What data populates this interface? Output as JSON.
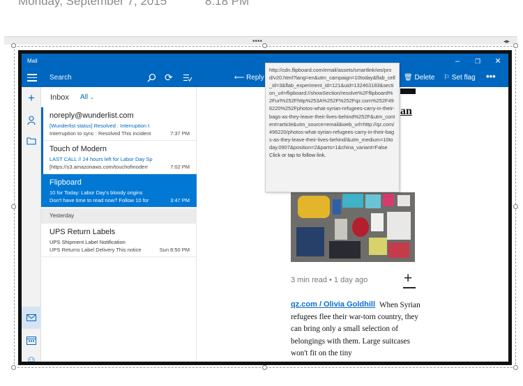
{
  "document": {
    "date": "Monday, September 7, 2015",
    "time": "8:18 PM"
  },
  "app": {
    "title": "Mail"
  },
  "toolbar": {
    "search_placeholder": "Search",
    "reply_label": "Reply",
    "delete_label": "Delete",
    "set_flag_label": "Set flag",
    "more_label": "•••"
  },
  "mail_list": {
    "folder": "Inbox",
    "filter": "All",
    "messages": [
      {
        "sender": "noreply@wunderlist.com",
        "subject": "[Wunderlist status] Resolved : Interruption t",
        "preview": "Interruption to sync : Resolved This incident",
        "time": "7:37 PM"
      },
      {
        "sender": "Touch of Modern",
        "subject": "LAST CALL // 24 hours left for Labor Day Sp",
        "preview": "[https://s3.amazonaws.com/touchofmoderr",
        "time": "7:02 PM"
      },
      {
        "sender": "Flipboard",
        "subject": "10 for Today: Labor Day's bloody origins",
        "preview": "Don't have time to read now? Follow 10 for",
        "time": "3:47 PM"
      }
    ],
    "group_label": "Yesterday",
    "older_messages": [
      {
        "sender": "UPS Return Labels",
        "subject": "UPS Shipment Label Notification",
        "preview": "UPS Returns Label Delivery This notice",
        "time": "Sun 8:50 PM"
      }
    ]
  },
  "tooltip": {
    "url": "http://cdn.flipboard.com/email/assets/smartlink/ws/prod/v20.html?lang=en&utm_campaign=10today&flab_cell_id=3&flab_experiment_id=121&uid=132463183&section_url=flipboard://showSection/resolve%2Fflipboard%2Furl%252Fhttp%253A%252F%252Fqz.com%252F496220%252Fphotos-what-syrian-refugees-carry-in-their-bags-as-they-leave-their-lives-behind%252F&utm_content=article&utm_source=email&web_url=http://qz.com/496220/photos-what-syrian-refugees-carry-in-their-bags-as-they-leave-their-lives-behind/&utm_medium=10today.0907&position=2&parts=1&china_variant=False",
    "hint": "Click or tap to follow link."
  },
  "article": {
    "headline_fragment": "an",
    "read_time": "3 min read • 1 day ago",
    "byline": "qz.com / Olivia Goldhill",
    "body": "When Syrian refugees flee their war-torn country, they can bring only a small selection of belongings with them. Large suitcases won't fit on the tiny"
  },
  "colors": {
    "accent": "#0067c0",
    "selected_row": "#0078d4",
    "link": "#0b6fd0"
  },
  "icons": [
    "search-icon",
    "sync-icon",
    "filter-icon",
    "reply-icon",
    "delete-icon",
    "flag-icon",
    "compose-icon",
    "account-icon",
    "folder-icon",
    "mail-icon",
    "calendar-icon",
    "feedback-icon",
    "settings-icon"
  ]
}
